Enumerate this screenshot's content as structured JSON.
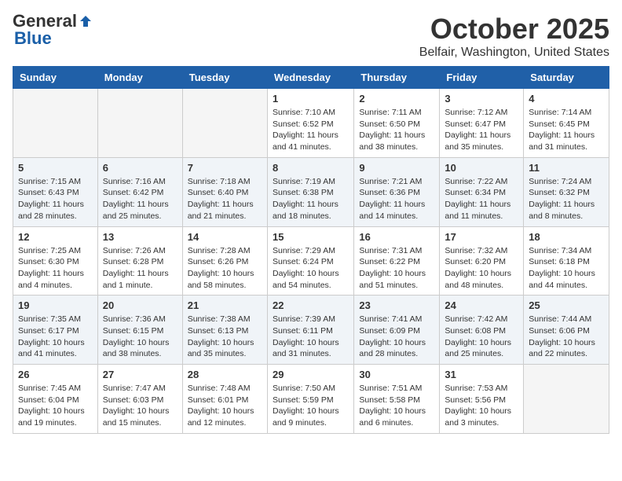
{
  "logo": {
    "general": "General",
    "blue": "Blue"
  },
  "header": {
    "month": "October 2025",
    "location": "Belfair, Washington, United States"
  },
  "weekdays": [
    "Sunday",
    "Monday",
    "Tuesday",
    "Wednesday",
    "Thursday",
    "Friday",
    "Saturday"
  ],
  "weeks": [
    [
      {
        "day": "",
        "info": ""
      },
      {
        "day": "",
        "info": ""
      },
      {
        "day": "",
        "info": ""
      },
      {
        "day": "1",
        "info": "Sunrise: 7:10 AM\nSunset: 6:52 PM\nDaylight: 11 hours and 41 minutes."
      },
      {
        "day": "2",
        "info": "Sunrise: 7:11 AM\nSunset: 6:50 PM\nDaylight: 11 hours and 38 minutes."
      },
      {
        "day": "3",
        "info": "Sunrise: 7:12 AM\nSunset: 6:47 PM\nDaylight: 11 hours and 35 minutes."
      },
      {
        "day": "4",
        "info": "Sunrise: 7:14 AM\nSunset: 6:45 PM\nDaylight: 11 hours and 31 minutes."
      }
    ],
    [
      {
        "day": "5",
        "info": "Sunrise: 7:15 AM\nSunset: 6:43 PM\nDaylight: 11 hours and 28 minutes."
      },
      {
        "day": "6",
        "info": "Sunrise: 7:16 AM\nSunset: 6:42 PM\nDaylight: 11 hours and 25 minutes."
      },
      {
        "day": "7",
        "info": "Sunrise: 7:18 AM\nSunset: 6:40 PM\nDaylight: 11 hours and 21 minutes."
      },
      {
        "day": "8",
        "info": "Sunrise: 7:19 AM\nSunset: 6:38 PM\nDaylight: 11 hours and 18 minutes."
      },
      {
        "day": "9",
        "info": "Sunrise: 7:21 AM\nSunset: 6:36 PM\nDaylight: 11 hours and 14 minutes."
      },
      {
        "day": "10",
        "info": "Sunrise: 7:22 AM\nSunset: 6:34 PM\nDaylight: 11 hours and 11 minutes."
      },
      {
        "day": "11",
        "info": "Sunrise: 7:24 AM\nSunset: 6:32 PM\nDaylight: 11 hours and 8 minutes."
      }
    ],
    [
      {
        "day": "12",
        "info": "Sunrise: 7:25 AM\nSunset: 6:30 PM\nDaylight: 11 hours and 4 minutes."
      },
      {
        "day": "13",
        "info": "Sunrise: 7:26 AM\nSunset: 6:28 PM\nDaylight: 11 hours and 1 minute."
      },
      {
        "day": "14",
        "info": "Sunrise: 7:28 AM\nSunset: 6:26 PM\nDaylight: 10 hours and 58 minutes."
      },
      {
        "day": "15",
        "info": "Sunrise: 7:29 AM\nSunset: 6:24 PM\nDaylight: 10 hours and 54 minutes."
      },
      {
        "day": "16",
        "info": "Sunrise: 7:31 AM\nSunset: 6:22 PM\nDaylight: 10 hours and 51 minutes."
      },
      {
        "day": "17",
        "info": "Sunrise: 7:32 AM\nSunset: 6:20 PM\nDaylight: 10 hours and 48 minutes."
      },
      {
        "day": "18",
        "info": "Sunrise: 7:34 AM\nSunset: 6:18 PM\nDaylight: 10 hours and 44 minutes."
      }
    ],
    [
      {
        "day": "19",
        "info": "Sunrise: 7:35 AM\nSunset: 6:17 PM\nDaylight: 10 hours and 41 minutes."
      },
      {
        "day": "20",
        "info": "Sunrise: 7:36 AM\nSunset: 6:15 PM\nDaylight: 10 hours and 38 minutes."
      },
      {
        "day": "21",
        "info": "Sunrise: 7:38 AM\nSunset: 6:13 PM\nDaylight: 10 hours and 35 minutes."
      },
      {
        "day": "22",
        "info": "Sunrise: 7:39 AM\nSunset: 6:11 PM\nDaylight: 10 hours and 31 minutes."
      },
      {
        "day": "23",
        "info": "Sunrise: 7:41 AM\nSunset: 6:09 PM\nDaylight: 10 hours and 28 minutes."
      },
      {
        "day": "24",
        "info": "Sunrise: 7:42 AM\nSunset: 6:08 PM\nDaylight: 10 hours and 25 minutes."
      },
      {
        "day": "25",
        "info": "Sunrise: 7:44 AM\nSunset: 6:06 PM\nDaylight: 10 hours and 22 minutes."
      }
    ],
    [
      {
        "day": "26",
        "info": "Sunrise: 7:45 AM\nSunset: 6:04 PM\nDaylight: 10 hours and 19 minutes."
      },
      {
        "day": "27",
        "info": "Sunrise: 7:47 AM\nSunset: 6:03 PM\nDaylight: 10 hours and 15 minutes."
      },
      {
        "day": "28",
        "info": "Sunrise: 7:48 AM\nSunset: 6:01 PM\nDaylight: 10 hours and 12 minutes."
      },
      {
        "day": "29",
        "info": "Sunrise: 7:50 AM\nSunset: 5:59 PM\nDaylight: 10 hours and 9 minutes."
      },
      {
        "day": "30",
        "info": "Sunrise: 7:51 AM\nSunset: 5:58 PM\nDaylight: 10 hours and 6 minutes."
      },
      {
        "day": "31",
        "info": "Sunrise: 7:53 AM\nSunset: 5:56 PM\nDaylight: 10 hours and 3 minutes."
      },
      {
        "day": "",
        "info": ""
      }
    ]
  ]
}
